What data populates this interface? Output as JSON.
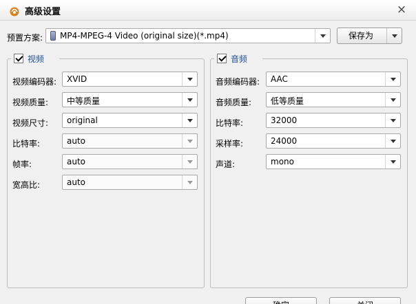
{
  "window": {
    "title": "高级设置",
    "close_symbol": "×"
  },
  "preset": {
    "label": "预置方案:",
    "value": "MP4-MPEG-4 Video (original size)(*.mp4)",
    "save_as_label": "保存为"
  },
  "video": {
    "legend": "视频",
    "enabled": true,
    "fields": [
      {
        "label": "视频编码器:",
        "value": "XVID"
      },
      {
        "label": "视频质量:",
        "value": "中等质量"
      },
      {
        "label": "视频尺寸:",
        "value": "original"
      },
      {
        "label": "比特率:",
        "value": "auto"
      },
      {
        "label": "帧率:",
        "value": "auto"
      },
      {
        "label": "宽高比:",
        "value": "auto"
      }
    ]
  },
  "audio": {
    "legend": "音频",
    "enabled": true,
    "fields": [
      {
        "label": "音频编码器:",
        "value": "AAC"
      },
      {
        "label": "音频质量:",
        "value": "低等质量"
      },
      {
        "label": "比特率:",
        "value": "32000"
      },
      {
        "label": "采样率:",
        "value": "24000"
      },
      {
        "label": "声道:",
        "value": "mono"
      }
    ]
  },
  "footer": {
    "ok_label": "确定",
    "close_label": "关闭"
  },
  "colors": {
    "legend_text": "#1f4f9c",
    "panel_background": "#f0f0f0",
    "app_icon_accent": "#d9821f"
  },
  "icons": {
    "app": "app-logo-icon",
    "preset": "device-icon",
    "close": "close-icon"
  }
}
